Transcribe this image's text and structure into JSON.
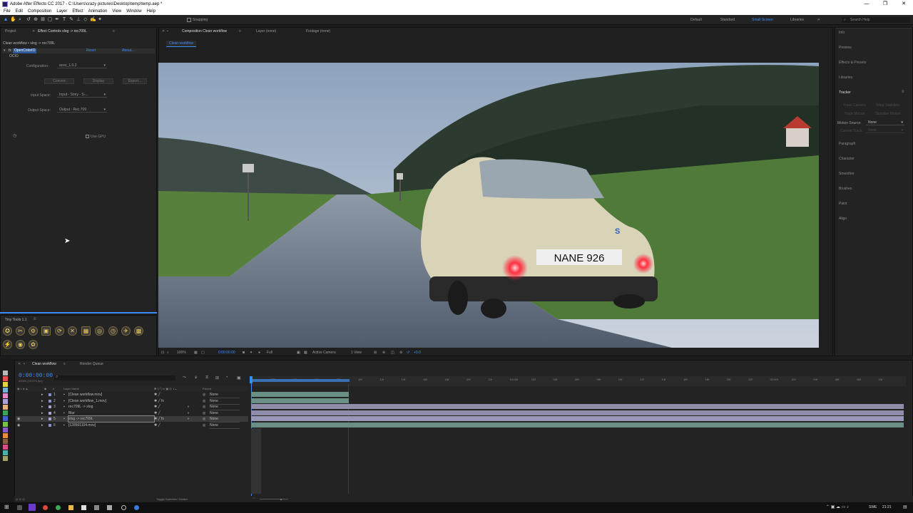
{
  "app": {
    "title": "Adobe After Effects CC 2017 - C:\\Users\\crazy pictures\\Desktop\\temp\\temp.aep *",
    "window_buttons": [
      "—",
      "❐",
      "✕"
    ]
  },
  "menu": [
    "File",
    "Edit",
    "Composition",
    "Layer",
    "Effect",
    "Animation",
    "View",
    "Window",
    "Help"
  ],
  "toolbar": {
    "snapping_label": "Snapping",
    "workspaces": [
      "Default",
      "Standard",
      "Small Screen",
      "Libraries"
    ],
    "active_workspace": "Small Screen",
    "search_placeholder": "Search Help"
  },
  "effect_panel": {
    "tab_project": "Project",
    "tab_effect_controls": "Effect Controls slog -> rec709L",
    "breadcrumb": "Clean workflow • slog -> rec709L",
    "effect_name": "OpenColorIO",
    "reset_label": "Reset",
    "about_label": "About...",
    "sub_name": "OCIO",
    "configuration_label": "Configuration:",
    "configuration_value": "aces_1.0.3",
    "convert_label": "Convert",
    "display_label": "Display",
    "export_label": "Export...",
    "input_space_label": "Input Space:",
    "input_space_value": "Input - Sony - S-...",
    "output_space_label": "Output Space:",
    "output_space_value": "Output - Rec.709",
    "use_gpu_label": "Use GPU"
  },
  "tiny_tools": {
    "title": "Tiny Tools 1.1",
    "glyphs": [
      "✪",
      "✂",
      "⚙",
      "▣",
      "⟳",
      "✕",
      "▦",
      "◎",
      "◷",
      "✈",
      "▩",
      "⚡",
      "◉",
      "✿"
    ]
  },
  "composition": {
    "tab_composition": "Composition Clean workflow",
    "tab_layer": "Layer (none)",
    "tab_footage": "Footage (none)",
    "comp_tab": "Clean workflow",
    "license_plate": "NANE 926",
    "car_badge": "S",
    "zoom": "100%",
    "timecode": "0:00:00:00",
    "resolution": "Full",
    "camera": "Active Camera",
    "views": "1 View",
    "exposure": "+0.0"
  },
  "right_panel": {
    "items": [
      "Info",
      "Preview",
      "Effects & Presets",
      "Libraries",
      "Tracker",
      "Paragraph",
      "Character",
      "Smoother",
      "Brushes",
      "Paint",
      "Align"
    ],
    "tracker_buttons": [
      "Track Camera",
      "Warp Stabilizer",
      "Track Motion",
      "Stabilize Motion"
    ],
    "motion_source_label": "Motion Source:",
    "motion_source_value": "None",
    "current_track_label": "Current Track:",
    "current_track_value": "None"
  },
  "timeline": {
    "tab_comp": "Clean workflow",
    "tab_render": "Render Queue",
    "timecode": "0:00:00:00",
    "timecode_sub": "00000 (23.976 fps)",
    "col_layer_name": "Layer Name",
    "col_parent": "Parent",
    "layers": [
      {
        "num": "1",
        "name": "[Clean workflow.mov]",
        "parent": "None",
        "color": "#8a8fd0"
      },
      {
        "num": "2",
        "name": "[Clean workflow_1.mov]",
        "parent": "None",
        "color": "#8a8fd0"
      },
      {
        "num": "3",
        "name": "rec709L -> slog",
        "parent": "None",
        "color": "#a4a4d8"
      },
      {
        "num": "4",
        "name": "Blur",
        "parent": "None",
        "color": "#a4a4d8"
      },
      {
        "num": "5",
        "name": "slog -> rec709L",
        "parent": "None",
        "color": "#a4a4d8"
      },
      {
        "num": "6",
        "name": "[128501104.mov]",
        "parent": "None",
        "color": "#8a8fd0"
      }
    ],
    "ruler_ticks": [
      "0s",
      "02f",
      "04f",
      "06f",
      "08f",
      "10f",
      "12f",
      "14f",
      "16f",
      "18f",
      "20f",
      "22f",
      "01:00f",
      "02f",
      "04f",
      "06f",
      "08f",
      "10f",
      "12f",
      "14f",
      "16f",
      "18f",
      "20f",
      "22f",
      "02:00f",
      "02f",
      "04f",
      "06f",
      "08f",
      "10f"
    ],
    "toggle_label": "Toggle Switches / Modes"
  },
  "label_colors": [
    "#b8b8b8",
    "#e25050",
    "#e6d24a",
    "#6fb1d8",
    "#e58ac8",
    "#b0a0e0",
    "#e5b27a",
    "#3fa35a",
    "#4464c8",
    "#79c24a",
    "#8a5cc8",
    "#e09040",
    "#8a6040",
    "#d8508a",
    "#4ab0a8",
    "#a0a068"
  ],
  "taskbar": {
    "language": "SWE",
    "time": "21:21"
  }
}
